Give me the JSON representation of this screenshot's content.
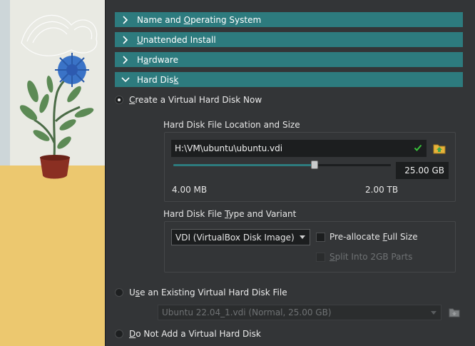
{
  "sections": [
    {
      "label_pre": "Name and ",
      "label_mnemonic": "O",
      "label_post": "perating System",
      "expanded": false
    },
    {
      "label_pre": "",
      "label_mnemonic": "U",
      "label_post": "nattended Install",
      "expanded": false
    },
    {
      "label_pre": "H",
      "label_mnemonic": "a",
      "label_post": "rdware",
      "expanded": false
    },
    {
      "label_pre": "Hard Dis",
      "label_mnemonic": "k",
      "label_post": "",
      "expanded": true
    }
  ],
  "options": {
    "create_new": {
      "pre": "",
      "mnemonic": "C",
      "post": "reate a Virtual Hard Disk Now",
      "selected": true
    },
    "use_existing": {
      "pre": "U",
      "mnemonic": "s",
      "post": "e an Existing Virtual Hard Disk File",
      "selected": false
    },
    "do_not_add": {
      "pre": "",
      "mnemonic": "D",
      "post": "o Not Add a Virtual Hard Disk",
      "selected": false
    }
  },
  "location_group": {
    "title": "Hard Disk File Location and Size",
    "path_value": "H:\\VM\\ubuntu\\ubuntu.vdi",
    "size_value": "25.00 GB",
    "slider_fraction": 0.65,
    "min_label": "4.00 MB",
    "max_label": "2.00 TB"
  },
  "type_group": {
    "title_pre": "Hard Disk File ",
    "title_mnemonic": "T",
    "title_post": "ype and Variant",
    "format_selected": "VDI (VirtualBox Disk Image)",
    "preallocate": {
      "pre": "Pre-allocate ",
      "mnemonic": "F",
      "post": "ull Size",
      "checked": false
    },
    "split": {
      "pre": "",
      "mnemonic": "S",
      "post": "plit Into 2GB Parts",
      "checked": false,
      "disabled": true
    }
  },
  "existing": {
    "selected": "Ubuntu 22.04_1.vdi (Normal, 25.00 GB)"
  },
  "colors": {
    "accent": "#2d7b7e",
    "background": "#333537",
    "field": "#1c1e1f",
    "check_green": "#38c23a"
  },
  "icons": {
    "section_collapsed": "chevron-right-icon",
    "section_expanded": "chevron-down-icon",
    "path_valid": "check-icon",
    "browse": "folder-browse-icon"
  }
}
